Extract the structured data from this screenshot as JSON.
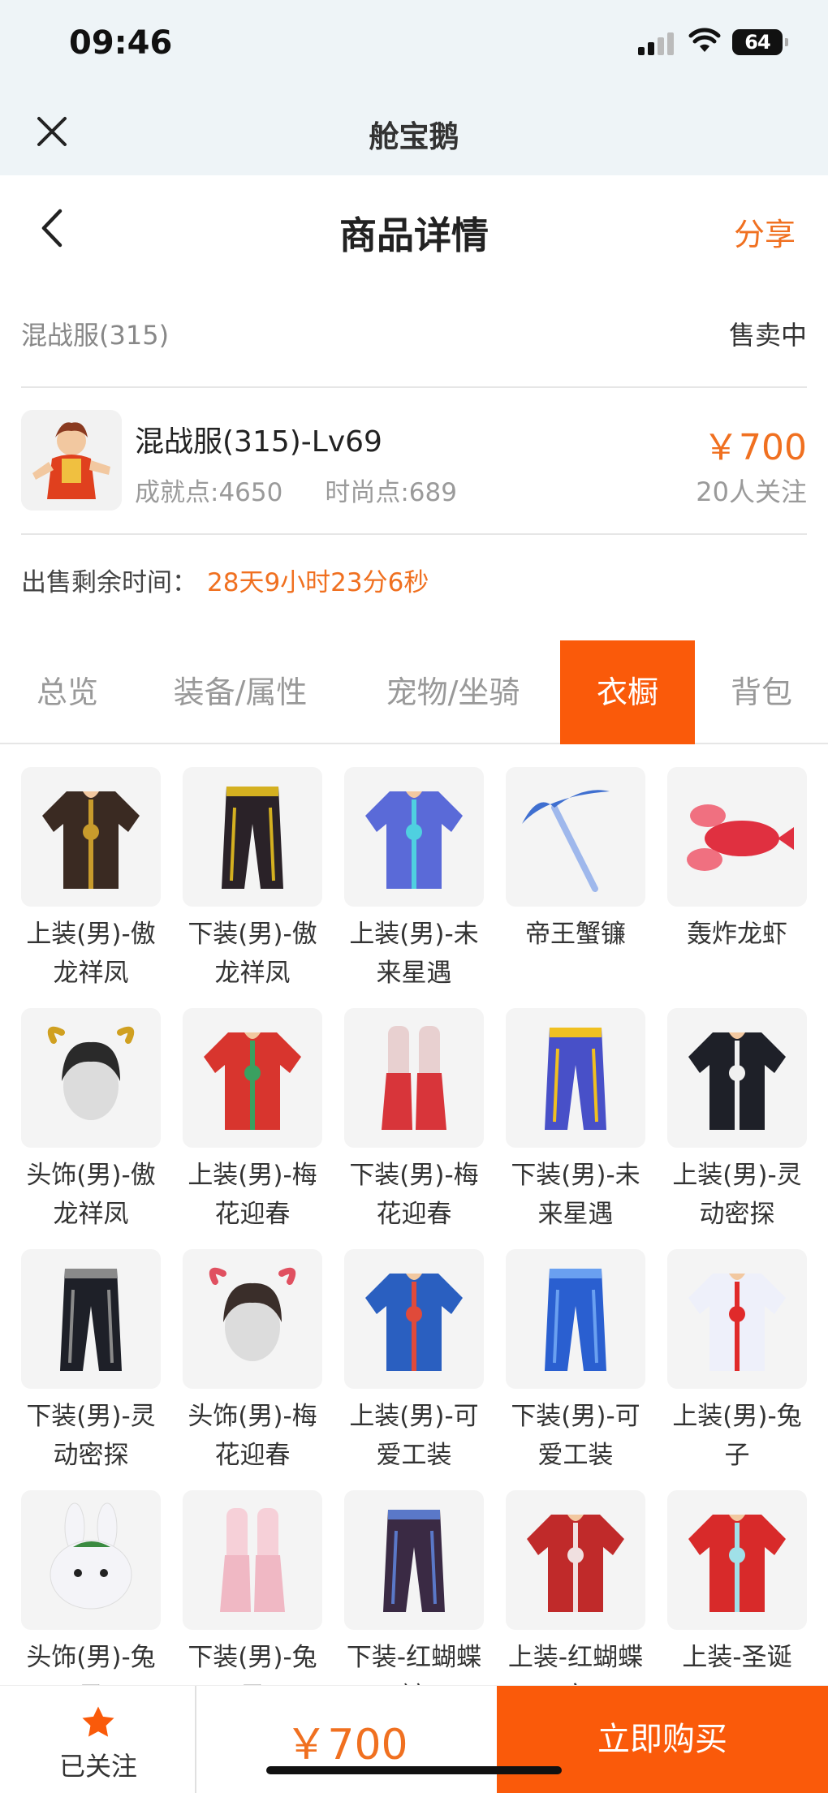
{
  "status_bar": {
    "time": "09:46",
    "battery": "64"
  },
  "app_bar": {
    "title": "舱宝鹅"
  },
  "nav": {
    "title": "商品详情",
    "share_label": "分享"
  },
  "listing": {
    "server": "混战服(315)",
    "status": "售卖中",
    "name": "混战服(315)-Lv69",
    "achievement": "成就点:4650",
    "fashion": "时尚点:689",
    "price": "￥700",
    "followers": "20人关注",
    "remaining_label": "出售剩余时间：",
    "remaining_time": "28天9小时23分6秒"
  },
  "tabs": [
    {
      "label": "总览",
      "active": false
    },
    {
      "label": "装备/属性",
      "active": false
    },
    {
      "label": "宠物/坐骑",
      "active": false
    },
    {
      "label": "衣橱",
      "active": true
    },
    {
      "label": "背包",
      "active": false
    }
  ],
  "wardrobe": [
    {
      "name": "上装(男)-傲龙祥凤",
      "color": "#3a2a22",
      "accent": "#c89b2c",
      "icon": "top-icon"
    },
    {
      "name": "下装(男)-傲龙祥凤",
      "color": "#2a2228",
      "accent": "#d4b020",
      "icon": "pants-icon"
    },
    {
      "name": "上装(男)-未来星遇",
      "color": "#5a6ad8",
      "accent": "#4fd0e0",
      "icon": "top-icon"
    },
    {
      "name": "帝王蟹镰",
      "color": "#3f6fd0",
      "accent": "#9fb8ec",
      "icon": "scythe-icon"
    },
    {
      "name": "轰炸龙虾",
      "color": "#e03040",
      "accent": "#f07080",
      "icon": "lobster-icon"
    },
    {
      "name": "头饰(男)-傲龙祥凤",
      "color": "#2a2a2a",
      "accent": "#d0a020",
      "icon": "head-icon"
    },
    {
      "name": "上装(男)-梅花迎春",
      "color": "#d8352e",
      "accent": "#3aa060",
      "icon": "top-icon"
    },
    {
      "name": "下装(男)-梅花迎春",
      "color": "#d8353a",
      "accent": "#e8d0d0",
      "icon": "boots-icon"
    },
    {
      "name": "下装(男)-未来星遇",
      "color": "#4850c8",
      "accent": "#f0c020",
      "icon": "pants-icon"
    },
    {
      "name": "上装(男)-灵动密探",
      "color": "#1e2028",
      "accent": "#f0f0f0",
      "icon": "top-icon"
    },
    {
      "name": "下装(男)-灵动密探",
      "color": "#1e2028",
      "accent": "#8a8a8a",
      "icon": "pants-icon"
    },
    {
      "name": "头饰(男)-梅花迎春",
      "color": "#3a2e2a",
      "accent": "#e05060",
      "icon": "head-icon"
    },
    {
      "name": "上装(男)-可爱工装",
      "color": "#2a5fc0",
      "accent": "#e04a3a",
      "icon": "top-icon"
    },
    {
      "name": "下装(男)-可爱工装",
      "color": "#2a5fd0",
      "accent": "#6aa0f0",
      "icon": "pants-icon"
    },
    {
      "name": "上装(男)-兔子",
      "color": "#eef0fa",
      "accent": "#e02a2a",
      "icon": "top-icon"
    },
    {
      "name": "头饰(男)-兔子",
      "color": "#f4f4f8",
      "accent": "#3a8a40",
      "icon": "bunny-icon"
    },
    {
      "name": "下装(男)-兔子",
      "color": "#f0b8c4",
      "accent": "#f6d0d8",
      "icon": "boots-icon"
    },
    {
      "name": "下装-红蝴蝶裤",
      "color": "#3a2a44",
      "accent": "#5a78c8",
      "icon": "pants-icon"
    },
    {
      "name": "上装-红蝴蝶衣",
      "color": "#c02a2a",
      "accent": "#f0e0e0",
      "icon": "top-icon"
    },
    {
      "name": "上装-圣诞",
      "color": "#d82a2a",
      "accent": "#a0e0e8",
      "icon": "top-icon"
    }
  ],
  "bottom": {
    "follow_label": "已关注",
    "price": "￥700",
    "buy_label": "立即购买"
  }
}
